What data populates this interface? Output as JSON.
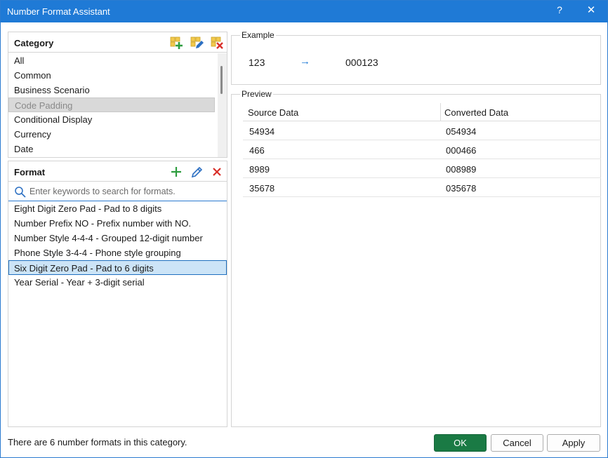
{
  "window": {
    "title": "Number Format Assistant",
    "help": "?",
    "close": "✕"
  },
  "category": {
    "label": "Category",
    "items": [
      "All",
      "Common",
      "Business Scenario",
      "Code Padding",
      "Conditional Display",
      "Currency",
      "Date"
    ],
    "selected_index": 3
  },
  "format": {
    "label": "Format",
    "search_placeholder": "Enter keywords to search for formats.",
    "items": [
      "Eight Digit Zero Pad - Pad to 8 digits",
      "Number Prefix NO - Prefix number with NO.",
      "Number Style 4-4-4 - Grouped 12-digit number",
      "Phone Style 3-4-4 - Phone style grouping",
      "Six Digit Zero Pad - Pad to 6 digits",
      "Year Serial - Year + 3-digit serial"
    ],
    "selected_index": 4
  },
  "example": {
    "legend": "Example",
    "source": "123",
    "arrow": "→",
    "converted": "000123"
  },
  "preview": {
    "legend": "Preview",
    "columns": [
      "Source Data",
      "Converted Data"
    ],
    "rows": [
      [
        "54934",
        "054934"
      ],
      [
        "466",
        "000466"
      ],
      [
        "8989",
        "008989"
      ],
      [
        "35678",
        "035678"
      ]
    ]
  },
  "status_text": "There are 6 number formats in this category.",
  "buttons": {
    "ok": "OK",
    "cancel": "Cancel",
    "apply": "Apply"
  },
  "colors": {
    "titlebar": "#1f7ad6",
    "ok": "#1a7a44",
    "add": "#2e9d3f",
    "edit": "#2b6fc2",
    "delete": "#d9302a"
  }
}
